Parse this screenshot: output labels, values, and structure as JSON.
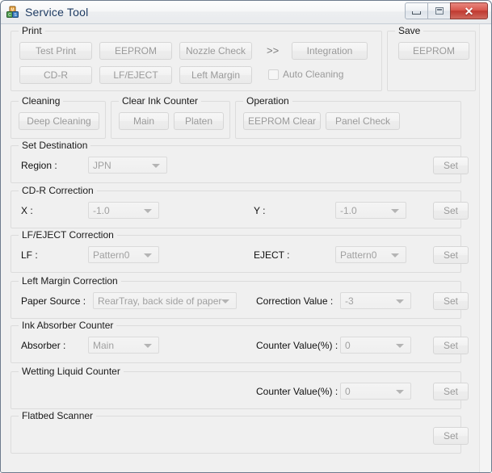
{
  "window": {
    "title": "Service Tool",
    "icon": "blocks-icon",
    "controls": {
      "minimize": "minimize-icon",
      "maximize": "maximize-icon",
      "close": "✕"
    }
  },
  "groups": {
    "print": {
      "legend": "Print",
      "buttons": [
        "Test Print",
        "EEPROM",
        "Nozzle Check",
        "CD-R",
        "LF/EJECT",
        "Left Margin"
      ],
      "chevron": ">>",
      "integration_label": "Integration",
      "auto_cleaning_label": "Auto Cleaning",
      "auto_cleaning_checked": false
    },
    "save": {
      "legend": "Save",
      "eeprom_label": "EEPROM"
    },
    "cleaning": {
      "legend": "Cleaning",
      "deep_cleaning_label": "Deep Cleaning"
    },
    "clear_ink_counter": {
      "legend": "Clear Ink Counter",
      "main_label": "Main",
      "platen_label": "Platen"
    },
    "operation": {
      "legend": "Operation",
      "eeprom_clear_label": "EEPROM Clear",
      "panel_check_label": "Panel Check"
    },
    "set_destination": {
      "legend": "Set Destination",
      "region_label": "Region :",
      "region_value": "JPN",
      "set_label": "Set"
    },
    "cdr_correction": {
      "legend": "CD-R Correction",
      "x_label": "X :",
      "x_value": "-1.0",
      "y_label": "Y :",
      "y_value": "-1.0",
      "set_label": "Set"
    },
    "lf_eject_correction": {
      "legend": "LF/EJECT Correction",
      "lf_label": "LF :",
      "lf_value": "Pattern0",
      "eject_label": "EJECT :",
      "eject_value": "Pattern0",
      "set_label": "Set"
    },
    "left_margin_correction": {
      "legend": "Left Margin Correction",
      "paper_source_label": "Paper Source :",
      "paper_source_value": "RearTray, back side of paper",
      "correction_value_label": "Correction Value :",
      "correction_value": "-3",
      "set_label": "Set"
    },
    "ink_absorber_counter": {
      "legend": "Ink Absorber Counter",
      "absorber_label": "Absorber :",
      "absorber_value": "Main",
      "counter_value_label": "Counter Value(%) :",
      "counter_value": "0",
      "set_label": "Set"
    },
    "wetting_liquid_counter": {
      "legend": "Wetting Liquid Counter",
      "counter_value_label": "Counter Value(%) :",
      "counter_value": "0",
      "set_label": "Set"
    },
    "flatbed_scanner": {
      "legend": "Flatbed Scanner",
      "set_label": "Set"
    }
  },
  "colors": {
    "window_bg": "#f0f0f0",
    "title_text": "#1f3c63",
    "group_border": "#dcdcdc",
    "disabled_text": "#9a9a9a",
    "close_button": "#bf3a31"
  }
}
